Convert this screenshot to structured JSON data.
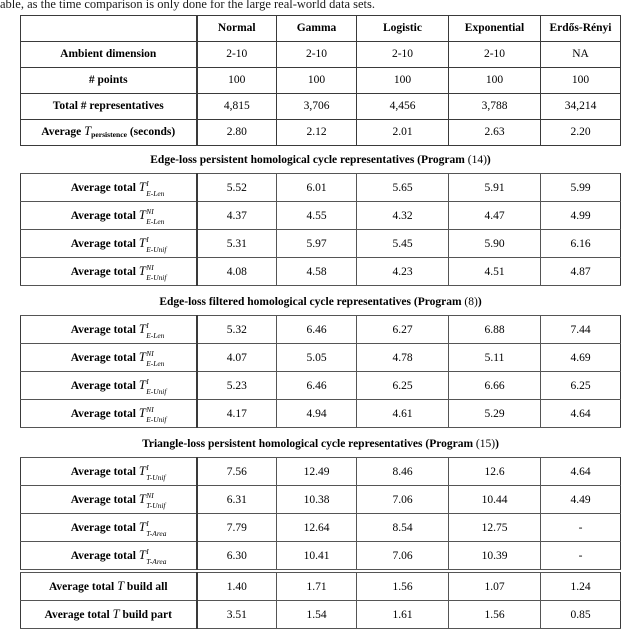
{
  "caption": {
    "partial_line": "able, as the time comparison is only done for the large real-world data sets."
  },
  "table": {
    "columns": [
      "",
      "Normal",
      "Gamma",
      "Logistic",
      "Exponential",
      "Erdős-Rényi"
    ],
    "top_rows": [
      {
        "label": "Ambient dimension",
        "values": [
          "2-10",
          "2-10",
          "2-10",
          "2-10",
          "NA"
        ]
      },
      {
        "label": "# points",
        "values": [
          "100",
          "100",
          "100",
          "100",
          "100"
        ]
      },
      {
        "label": "Total # representatives",
        "values": [
          "4,815",
          "3,706",
          "4,456",
          "3,788",
          "34,214"
        ]
      },
      {
        "label_prefix": "Average ",
        "label_var": "T",
        "label_sub": "persistence",
        "label_suffix": " (seconds)",
        "values": [
          "2.80",
          "2.12",
          "2.01",
          "2.63",
          "2.20"
        ]
      }
    ],
    "sections": [
      {
        "title_text": "Edge-loss persistent homological cycle representatives (Program ",
        "title_num": "(14)",
        "title_tail": ")",
        "rows": [
          {
            "prefix": "Average total ",
            "var": "T",
            "sup": "I",
            "sub": "E-Len",
            "values": [
              "5.52",
              "6.01",
              "5.65",
              "5.91",
              "5.99"
            ]
          },
          {
            "prefix": "Average total ",
            "var": "T",
            "sup": "NI",
            "sub": "E-Len",
            "values": [
              "4.37",
              "4.55",
              "4.32",
              "4.47",
              "4.99"
            ]
          },
          {
            "prefix": "Average total ",
            "var": "T",
            "sup": "I",
            "sub": "E-Unif",
            "values": [
              "5.31",
              "5.97",
              "5.45",
              "5.90",
              "6.16"
            ]
          },
          {
            "prefix": "Average total ",
            "var": "T",
            "sup": "NI",
            "sub": "E-Unif",
            "values": [
              "4.08",
              "4.58",
              "4.23",
              "4.51",
              "4.87"
            ]
          }
        ]
      },
      {
        "title_text": "Edge-loss filtered homological cycle representatives (Program ",
        "title_num": "(8)",
        "title_tail": ")",
        "rows": [
          {
            "prefix": "Average total ",
            "var": "T",
            "sup": "I",
            "sub": "E-Len",
            "values": [
              "5.32",
              "6.46",
              "6.27",
              "6.88",
              "7.44"
            ]
          },
          {
            "prefix": "Average total ",
            "var": "T",
            "sup": "NI",
            "sub": "E-Len",
            "values": [
              "4.07",
              "5.05",
              "4.78",
              "5.11",
              "4.69"
            ]
          },
          {
            "prefix": "Average total ",
            "var": "T",
            "sup": "I",
            "sub": "E-Unif",
            "values": [
              "5.23",
              "6.46",
              "6.25",
              "6.66",
              "6.25"
            ]
          },
          {
            "prefix": "Average total ",
            "var": "T",
            "sup": "NI",
            "sub": "E-Unif",
            "values": [
              "4.17",
              "4.94",
              "4.61",
              "5.29",
              "4.64"
            ]
          }
        ]
      },
      {
        "title_text": "Triangle-loss persistent homological cycle representatives (Program ",
        "title_num": "(15)",
        "title_tail": ")",
        "rows": [
          {
            "prefix": "Average total ",
            "var": "T",
            "sup": "I",
            "sub": "T-Unif",
            "values": [
              "7.56",
              "12.49",
              "8.46",
              "12.6",
              "4.64"
            ]
          },
          {
            "prefix": "Average total ",
            "var": "T",
            "sup": "NI",
            "sub": "T-Unif",
            "values": [
              "6.31",
              "10.38",
              "7.06",
              "10.44",
              "4.49"
            ]
          },
          {
            "prefix": "Average total ",
            "var": "T",
            "sup": "I",
            "sub": "T-Area",
            "values": [
              "7.79",
              "12.64",
              "8.54",
              "12.75",
              "-"
            ]
          },
          {
            "prefix": "Average total ",
            "var": "T",
            "sup": "I",
            "sub": "T-Area",
            "values": [
              "6.30",
              "10.41",
              "7.06",
              "10.39",
              "-"
            ]
          }
        ]
      }
    ],
    "bottom_rows": [
      {
        "prefix": "Average total ",
        "var": "T",
        "suffix": " build all",
        "values": [
          "1.40",
          "1.71",
          "1.56",
          "1.07",
          "1.24"
        ]
      },
      {
        "prefix": "Average total ",
        "var": "T",
        "suffix": " build part",
        "values": [
          "3.51",
          "1.54",
          "1.61",
          "1.56",
          "0.85"
        ]
      }
    ]
  }
}
